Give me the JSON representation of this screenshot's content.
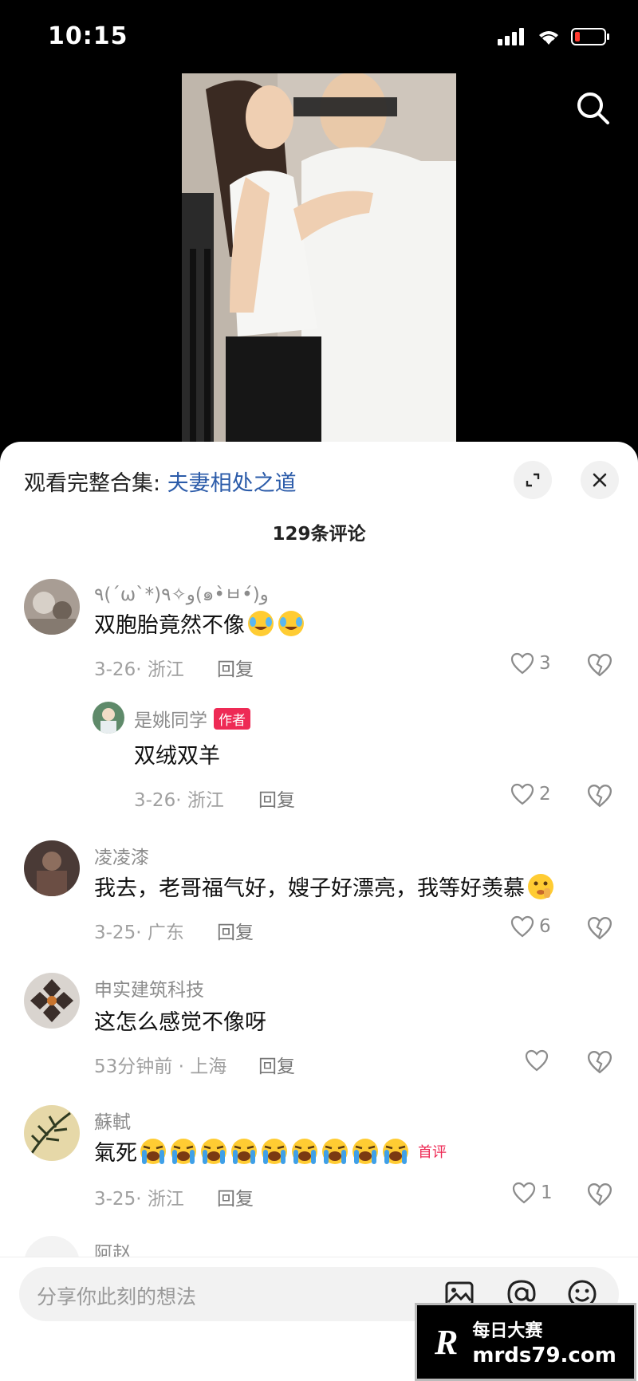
{
  "status": {
    "time": "10:15"
  },
  "sheet": {
    "collection_prefix": "观看完整合集: ",
    "collection_link": "夫妻相处之道",
    "comment_count": "129条评论"
  },
  "comments": [
    {
      "username": "٩(ˊωˋ*)و✧٩(๑•̀ㅂ•́)و",
      "text": "双胞胎竟然不像",
      "date": "3-26",
      "location": "浙江",
      "reply": "回复",
      "likes": "3"
    },
    {
      "username": "是姚同学",
      "badge": "作者",
      "text": "双绒双羊",
      "date": "3-26",
      "location": "浙江",
      "reply": "回复",
      "likes": "2"
    },
    {
      "username": "凌凌漆",
      "text": "我去，老哥福气好，嫂子好漂亮，我等好羡慕",
      "date": "3-25",
      "location": "广东",
      "reply": "回复",
      "likes": "6"
    },
    {
      "username": "申实建筑科技",
      "text": "这怎么感觉不像呀",
      "date": "53分钟前",
      "location": "上海",
      "reply": "回复",
      "likes": ""
    },
    {
      "username": "蘇軾",
      "text": "氣死",
      "badge": "首评",
      "date": "3-25",
      "location": "浙江",
      "reply": "回复",
      "likes": "1"
    },
    {
      "username": "阿赵"
    }
  ],
  "input": {
    "placeholder": "分享你此刻的想法"
  },
  "watermark": {
    "logo": "R",
    "line1": "每日大赛",
    "line2": "mrds79.com"
  },
  "icons": [
    "search-icon",
    "expand-icon",
    "close-icon",
    "heart-icon",
    "broken-heart-icon",
    "image-icon",
    "at-icon",
    "emoji-icon"
  ],
  "colors": {
    "link": "#2b5ba9",
    "badge": "#ee2a55"
  }
}
